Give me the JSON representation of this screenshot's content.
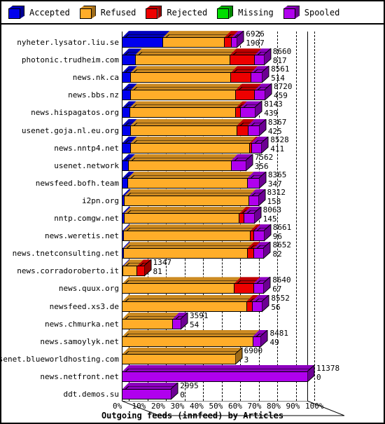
{
  "legend": {
    "items": [
      {
        "label": "Accepted",
        "color": "#0000ee",
        "icon": "cube-icon"
      },
      {
        "label": "Refused",
        "color": "#ffad29",
        "icon": "cube-icon"
      },
      {
        "label": "Rejected",
        "color": "#ee0000",
        "icon": "cube-icon"
      },
      {
        "label": "Missing",
        "color": "#00dd00",
        "icon": "cube-icon"
      },
      {
        "label": "Spooled",
        "color": "#b000ee",
        "icon": "cube-icon"
      }
    ]
  },
  "chart_data": {
    "type": "bar",
    "orientation": "horizontal",
    "stacked": true,
    "title": "",
    "xlabel": "Outgoing feeds (innfeed) by Articles",
    "ylabel": "",
    "xlim": [
      0,
      100
    ],
    "xunit": "%",
    "grid": true,
    "legend_position": "top",
    "xticks": [
      "0%",
      "10%",
      "20%",
      "30%",
      "40%",
      "50%",
      "60%",
      "70%",
      "80%",
      "90%",
      "100%"
    ],
    "series": [
      {
        "name": "Accepted",
        "color": "#0000ee"
      },
      {
        "name": "Refused",
        "color": "#ffad29"
      },
      {
        "name": "Rejected",
        "color": "#ee0000"
      },
      {
        "name": "Missing",
        "color": "#00dd00"
      },
      {
        "name": "Spooled",
        "color": "#b000ee"
      }
    ],
    "categories": [
      "nyheter.lysator.liu.se",
      "photonic.trudheim.com",
      "news.nk.ca",
      "news.bbs.nz",
      "news.hispagatos.org",
      "usenet.goja.nl.eu.org",
      "news.nntp4.net",
      "usenet.network",
      "newsfeed.bofh.team",
      "i2pn.org",
      "nntp.comgw.net",
      "news.weretis.net",
      "news.tnetconsulting.net",
      "news.corradoroberto.it",
      "news.quux.org",
      "newsfeed.xs3.de",
      "news.chmurka.net",
      "news.samoylyk.net",
      "usenet.blueworldhosting.com",
      "news.netfront.net",
      "ddt.demos.su"
    ],
    "rows": [
      {
        "category": "nyheter.lysator.liu.se",
        "total": "6926",
        "second": "1907",
        "pct_total": 62.0,
        "segments": [
          22.0,
          33.0,
          4.0,
          0.0,
          3.0
        ]
      },
      {
        "category": "photonic.trudheim.com",
        "total": "8660",
        "second": "817",
        "pct_total": 76.5,
        "segments": [
          7.0,
          51.0,
          13.5,
          0.0,
          5.0
        ]
      },
      {
        "category": "news.nk.ca",
        "total": "8561",
        "second": "514",
        "pct_total": 75.5,
        "segments": [
          4.5,
          54.0,
          11.0,
          0.0,
          6.0
        ]
      },
      {
        "category": "news.bbs.nz",
        "total": "8720",
        "second": "459",
        "pct_total": 77.0,
        "segments": [
          4.5,
          56.5,
          10.5,
          0.0,
          5.5
        ]
      },
      {
        "category": "news.hispagatos.org",
        "total": "8143",
        "second": "439",
        "pct_total": 71.8,
        "segments": [
          4.0,
          57.3,
          2.5,
          0.0,
          8.0
        ]
      },
      {
        "category": "usenet.goja.nl.eu.org",
        "total": "8367",
        "second": "425",
        "pct_total": 73.9,
        "segments": [
          4.5,
          57.4,
          6.0,
          0.0,
          6.0
        ]
      },
      {
        "category": "news.nntp4.net",
        "total": "8528",
        "second": "411",
        "pct_total": 75.2,
        "segments": [
          4.5,
          64.2,
          1.0,
          0.0,
          5.5
        ]
      },
      {
        "category": "usenet.network",
        "total": "7562",
        "second": "356",
        "pct_total": 66.7,
        "segments": [
          3.5,
          55.2,
          0.0,
          0.0,
          8.0
        ]
      },
      {
        "category": "newsfeed.bofh.team",
        "total": "8365",
        "second": "347",
        "pct_total": 73.9,
        "segments": [
          3.0,
          64.4,
          0.0,
          0.0,
          6.5
        ]
      },
      {
        "category": "i2pn.org",
        "total": "8312",
        "second": "158",
        "pct_total": 73.4,
        "segments": [
          1.2,
          67.2,
          0.0,
          0.0,
          5.0
        ]
      },
      {
        "category": "nntp.comgw.net",
        "total": "8063",
        "second": "145",
        "pct_total": 71.2,
        "segments": [
          1.0,
          62.2,
          2.5,
          0.0,
          5.5
        ]
      },
      {
        "category": "news.weretis.net",
        "total": "8661",
        "second": "96",
        "pct_total": 76.5,
        "segments": [
          0.7,
          68.3,
          2.0,
          0.0,
          5.5
        ]
      },
      {
        "category": "news.tnetconsulting.net",
        "total": "8652",
        "second": "82",
        "pct_total": 76.4,
        "segments": [
          0.7,
          66.7,
          3.5,
          0.0,
          5.5
        ]
      },
      {
        "category": "news.corradoroberto.it",
        "total": "1347",
        "second": "81",
        "pct_total": 11.9,
        "segments": [
          0.5,
          7.4,
          4.0,
          0.0,
          0.0
        ]
      },
      {
        "category": "news.quux.org",
        "total": "8640",
        "second": "67",
        "pct_total": 76.3,
        "segments": [
          0.0,
          60.3,
          10.5,
          0.0,
          5.5
        ]
      },
      {
        "category": "newsfeed.xs3.de",
        "total": "8552",
        "second": "56",
        "pct_total": 75.6,
        "segments": [
          0.0,
          67.1,
          3.0,
          0.0,
          5.5
        ]
      },
      {
        "category": "news.chmurka.net",
        "total": "3591",
        "second": "54",
        "pct_total": 31.7,
        "segments": [
          0.0,
          27.2,
          0.0,
          0.0,
          4.5
        ]
      },
      {
        "category": "news.samoylyk.net",
        "total": "8481",
        "second": "49",
        "pct_total": 74.9,
        "segments": [
          0.0,
          70.4,
          0.0,
          0.0,
          4.5
        ]
      },
      {
        "category": "usenet.blueworldhosting.com",
        "total": "6900",
        "second": "3",
        "pct_total": 61.0,
        "segments": [
          0.0,
          61.0,
          0.0,
          0.0,
          0.0
        ]
      },
      {
        "category": "news.netfront.net",
        "total": "11378",
        "second": "0",
        "pct_total": 100.0,
        "segments": [
          0.0,
          0.0,
          0.0,
          0.0,
          100.0
        ]
      },
      {
        "category": "ddt.demos.su",
        "total": "2995",
        "second": "0",
        "pct_total": 26.5,
        "segments": [
          0.0,
          0.0,
          0.0,
          0.0,
          26.5
        ]
      }
    ]
  }
}
